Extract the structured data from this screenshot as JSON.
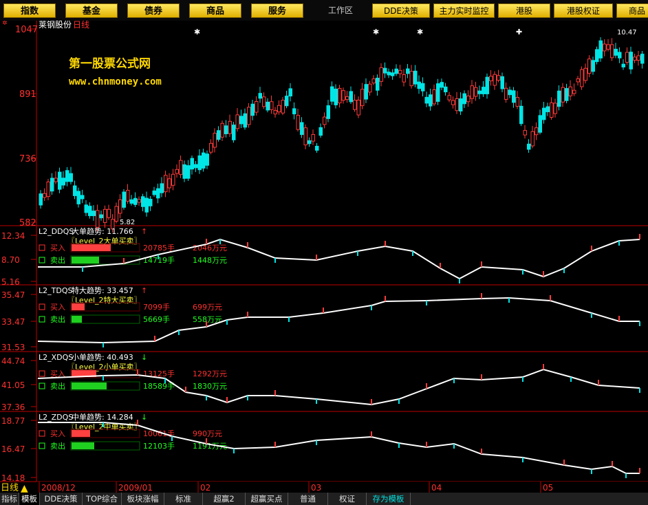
{
  "toolbar": {
    "buttons": [
      "指数",
      "基金",
      "债券",
      "商品",
      "服务"
    ],
    "workarea": "工作区",
    "right_buttons": [
      "DDE决策",
      "主力实时监控",
      "港股",
      "港股权证",
      "商品"
    ]
  },
  "main": {
    "stock_name": "莱钢股份",
    "period": "日线",
    "watermark_cn": "第一股票公式网",
    "watermark_en": "www.chnmoney.com",
    "y_ticks": [
      "1047",
      "891",
      "736",
      "582"
    ],
    "high_label": "10.47",
    "low_label": "5.82"
  },
  "panels": [
    {
      "id": "L2_DDQS",
      "trend_label": "大单趋势: 11.766",
      "subtitle": "〖Level_2大单买卖〗",
      "y_ticks": [
        "12.34",
        "8.70",
        "5.16"
      ],
      "buy_label": "买入",
      "buy_hands": "20785手",
      "buy_amount": "2046万元",
      "buy_ratio": 0.57,
      "sell_label": "卖出",
      "sell_hands": "14719手",
      "sell_amount": "1448万元",
      "sell_ratio": 0.4,
      "arrow": "↑"
    },
    {
      "id": "L2_TDQS",
      "trend_label": "特大趋势: 33.457",
      "subtitle": "〖Level_2特大买卖〗",
      "y_ticks": [
        "35.47",
        "33.47",
        "31.53"
      ],
      "buy_label": "买入",
      "buy_hands": "7099手",
      "buy_amount": "699万元",
      "buy_ratio": 0.19,
      "sell_label": "卖出",
      "sell_hands": "5669手",
      "sell_amount": "558万元",
      "sell_ratio": 0.15,
      "arrow": "↑"
    },
    {
      "id": "L2_XDQS",
      "trend_label": "小单趋势: 40.493",
      "subtitle": "〖Level_2小单买卖〗",
      "y_ticks": [
        "44.74",
        "41.05",
        "37.36"
      ],
      "buy_label": "买入",
      "buy_hands": "13125手",
      "buy_amount": "1292万元",
      "buy_ratio": 0.36,
      "sell_label": "卖出",
      "sell_hands": "18589手",
      "sell_amount": "1830万元",
      "sell_ratio": 0.51,
      "arrow": "↓"
    },
    {
      "id": "L2_ZDQS",
      "trend_label": "中单趋势: 14.284",
      "subtitle": "〖Level_2中单买卖〗",
      "y_ticks": [
        "18.77",
        "16.47",
        "14.18"
      ],
      "buy_label": "买入",
      "buy_hands": "10061手",
      "buy_amount": "990万元",
      "buy_ratio": 0.27,
      "sell_label": "卖出",
      "sell_hands": "12103手",
      "sell_amount": "1191万元",
      "sell_ratio": 0.33,
      "arrow": "↓"
    }
  ],
  "timeline": {
    "period_label": "日线",
    "labels": [
      "2008/12",
      "2009/01",
      "02",
      "03",
      "04",
      "05"
    ]
  },
  "bottom_tabs": [
    "指标",
    "模板",
    "DDE决策",
    "TOP综合",
    "板块涨幅",
    "标准",
    "超赢2",
    "超赢买点",
    "普通",
    "权证",
    "存为模板"
  ],
  "colors": {
    "up": "#ff3b3b",
    "down": "#00e5e5",
    "axis": "#c00000",
    "text_red": "#ff3030",
    "text_green": "#20ff20"
  }
}
